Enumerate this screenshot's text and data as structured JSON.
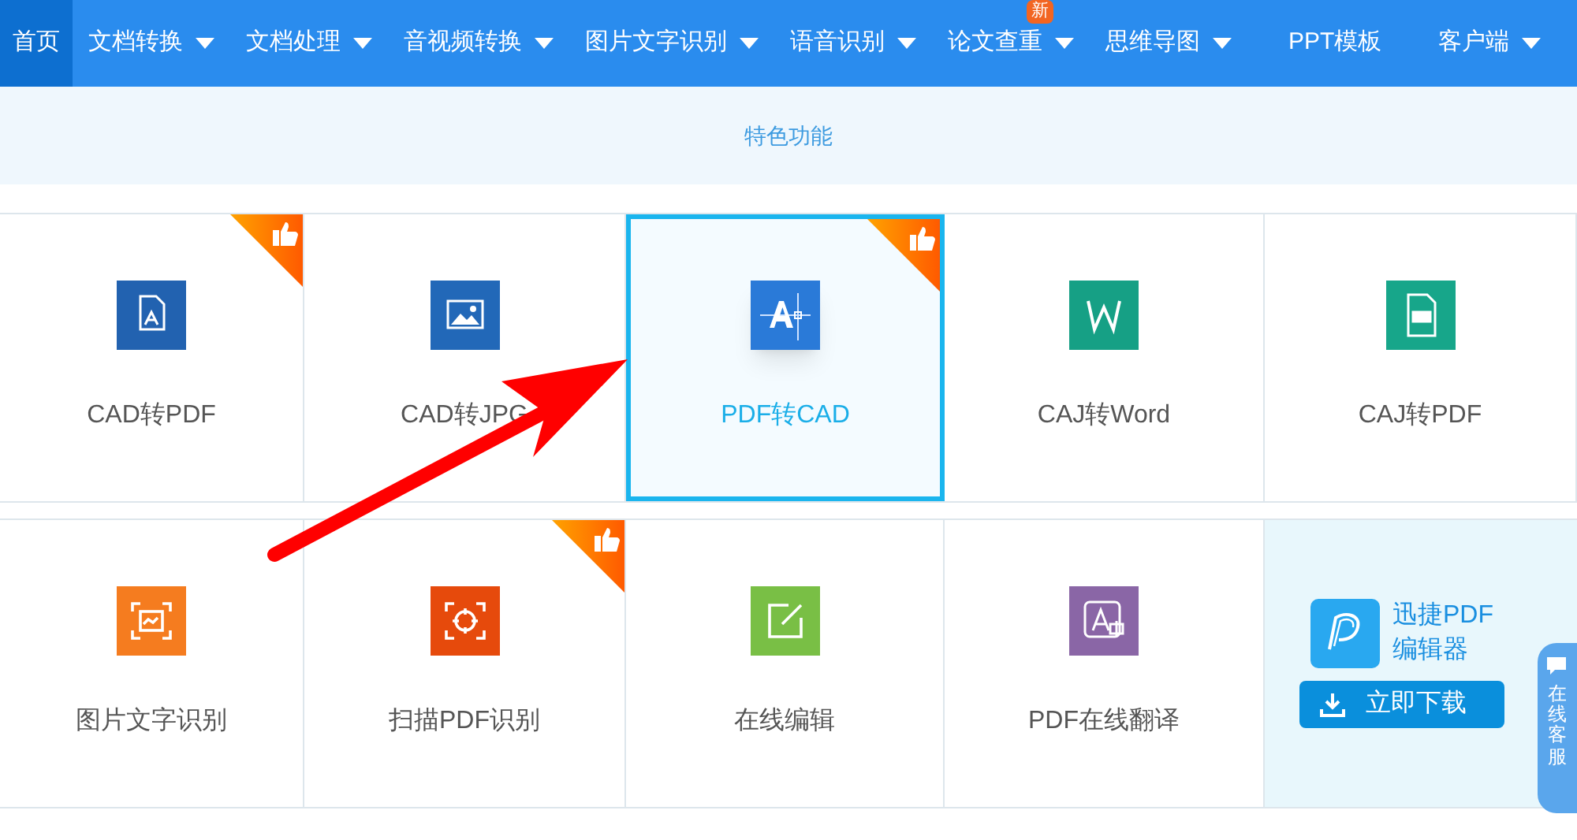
{
  "nav": [
    {
      "label": "首页",
      "selected": true,
      "dropdown": false
    },
    {
      "label": "文档转换",
      "selected": false,
      "dropdown": true
    },
    {
      "label": "文档处理",
      "selected": false,
      "dropdown": true
    },
    {
      "label": "音视频转换",
      "selected": false,
      "dropdown": true
    },
    {
      "label": "图片文字识别",
      "selected": false,
      "dropdown": true
    },
    {
      "label": "语音识别",
      "selected": false,
      "dropdown": true
    },
    {
      "label": "论文查重",
      "selected": false,
      "dropdown": true,
      "badge": "新"
    },
    {
      "label": "思维导图",
      "selected": false,
      "dropdown": true
    },
    {
      "label": "PPT模板",
      "selected": false,
      "dropdown": false
    },
    {
      "label": "客户端",
      "selected": false,
      "dropdown": true
    }
  ],
  "section_title": "特色功能",
  "rows": [
    [
      {
        "kind": "tool",
        "label": "CAD转PDF",
        "color": "#2262b0",
        "hot": true,
        "selected": false
      },
      {
        "kind": "tool",
        "label": "CAD转JPG",
        "color": "#2268b8",
        "hot": false,
        "selected": false
      },
      {
        "kind": "tool",
        "label": "PDF转CAD",
        "color": "#2a7ad8",
        "hot": true,
        "selected": true
      },
      {
        "kind": "tool",
        "label": "CAJ转Word",
        "color": "#16a085",
        "hot": false,
        "selected": false
      },
      {
        "kind": "tool",
        "label": "CAJ转PDF",
        "color": "#17a68a",
        "hot": false,
        "selected": false
      }
    ],
    [
      {
        "kind": "tool",
        "label": "图片文字识别",
        "color": "#f57c1f",
        "hot": false,
        "selected": false
      },
      {
        "kind": "tool",
        "label": "扫描PDF识别",
        "color": "#e64a0c",
        "hot": true,
        "selected": false
      },
      {
        "kind": "tool",
        "label": "在线编辑",
        "color": "#79bf45",
        "hot": false,
        "selected": false
      },
      {
        "kind": "tool",
        "label": "PDF在线翻译",
        "color": "#8a66a6",
        "hot": false,
        "selected": false
      },
      {
        "kind": "ad",
        "name": "迅捷PDF\n编辑器",
        "button": "立即下载"
      }
    ]
  ],
  "side_tab": "在线客服"
}
